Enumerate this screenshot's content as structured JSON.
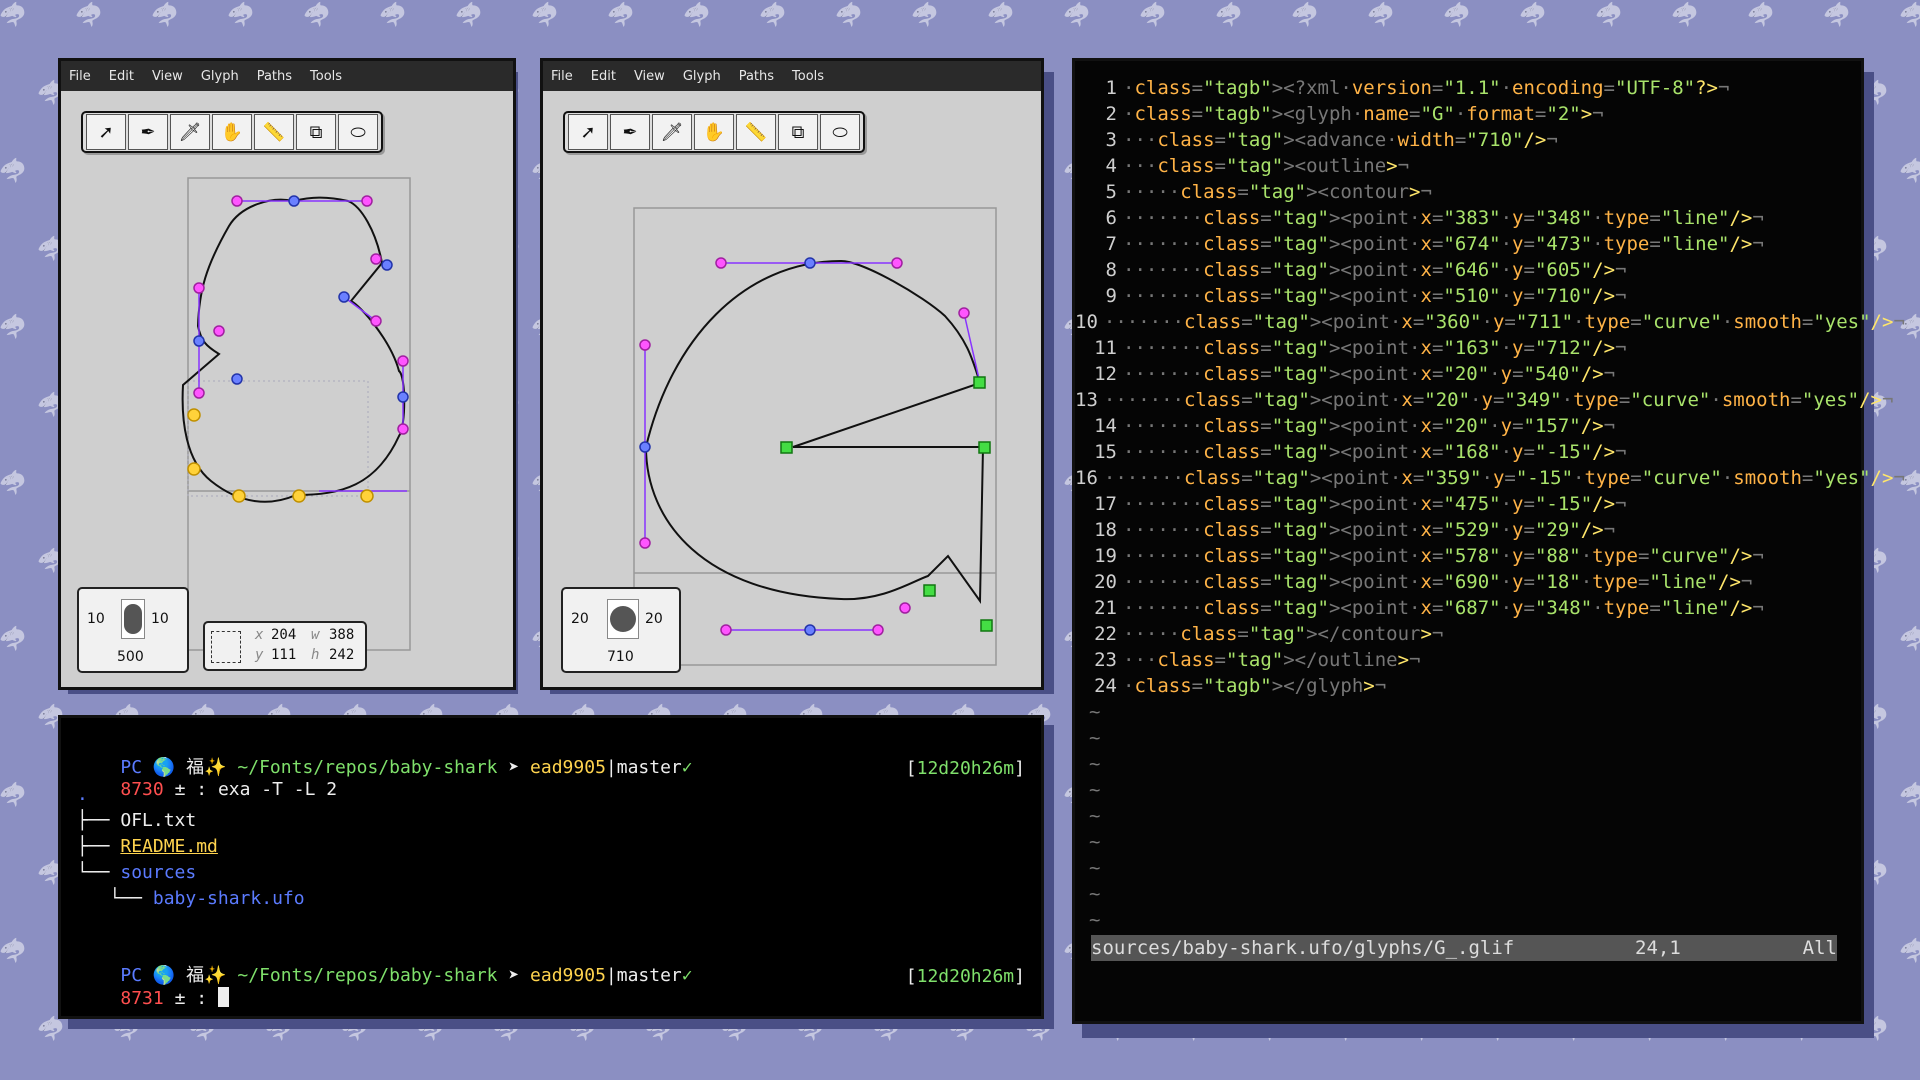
{
  "colors": {
    "background": "#8b8fc2",
    "on_curve": "#4a68ff",
    "off_curve": "#ff33ff",
    "line_point": "#33cc33",
    "selected": "#ffd23a"
  },
  "editor_left": {
    "menu": [
      "File",
      "Edit",
      "View",
      "Glyph",
      "Paths",
      "Tools"
    ],
    "tools": [
      "pointer-icon",
      "pen-icon",
      "knife-icon",
      "hand-icon",
      "ruler-icon",
      "shapes-icon",
      "ellipse-icon"
    ],
    "metrics": {
      "left": "10",
      "right": "10",
      "advance": "500"
    },
    "bbox": {
      "x_label": "x",
      "x": "204",
      "w_label": "w",
      "w": "388",
      "y_label": "y",
      "y": "111",
      "h_label": "h",
      "h": "242"
    }
  },
  "editor_right": {
    "menu": [
      "File",
      "Edit",
      "View",
      "Glyph",
      "Paths",
      "Tools"
    ],
    "tools": [
      "pointer-icon",
      "pen-icon",
      "knife-icon",
      "hand-icon",
      "ruler-icon",
      "shapes-icon",
      "ellipse-icon"
    ],
    "metrics": {
      "left": "20",
      "right": "20",
      "advance": "710"
    }
  },
  "terminal": {
    "prompt1": {
      "host": "PC",
      "globe": "🌎",
      "kanji": "福",
      "sparkle": "✨",
      "path": "~/Fonts/repos/baby-shark",
      "arrow": "➤",
      "commit": "ead9905",
      "branch": "|master",
      "check": "✓"
    },
    "cmd1": {
      "num": "8730",
      "pm": "±",
      "colon": ":",
      "cmd": "exa -T -L 2",
      "time": "12d20h26m"
    },
    "tree": {
      "root": ".",
      "items": [
        {
          "prefix": "├── ",
          "name": "OFL.txt"
        },
        {
          "prefix": "├── ",
          "name": "README.md"
        },
        {
          "prefix": "└── ",
          "name": "sources"
        },
        {
          "prefix": "   └── ",
          "name": "baby-shark.ufo"
        }
      ]
    },
    "prompt2": {
      "host": "PC",
      "globe": "🌎",
      "kanji": "福",
      "sparkle": "✨",
      "path": "~/Fonts/repos/baby-shark",
      "arrow": "➤",
      "commit": "ead9905",
      "branch": "|master",
      "check": "✓"
    },
    "cmd2": {
      "num": "8731",
      "pm": "±",
      "colon": ":",
      "time": "12d20h26m"
    }
  },
  "code": {
    "lines": [
      {
        "n": "1",
        "text": "<?xml version=\"1.1\" encoding=\"UTF-8\"?>¬"
      },
      {
        "n": "2",
        "text": "<glyph name=\"G\" format=\"2\">¬"
      },
      {
        "n": "3",
        "text": "··<advance width=\"710\"/>¬"
      },
      {
        "n": "4",
        "text": "··<outline>¬"
      },
      {
        "n": "5",
        "text": "····<contour>¬"
      },
      {
        "n": "6",
        "text": "······<point x=\"383\" y=\"348\" type=\"line\"/>¬"
      },
      {
        "n": "7",
        "text": "······<point x=\"674\" y=\"473\" type=\"line\"/>¬"
      },
      {
        "n": "8",
        "text": "······<point x=\"646\" y=\"605\"/>¬"
      },
      {
        "n": "9",
        "text": "······<point x=\"510\" y=\"710\"/>¬"
      },
      {
        "n": "10",
        "text": "······<point x=\"360\" y=\"711\" type=\"curve\" smooth=\"yes\"/>¬"
      },
      {
        "n": "11",
        "text": "······<point x=\"163\" y=\"712\"/>¬"
      },
      {
        "n": "12",
        "text": "······<point x=\"20\" y=\"540\"/>¬"
      },
      {
        "n": "13",
        "text": "······<point x=\"20\" y=\"349\" type=\"curve\" smooth=\"yes\"/>¬"
      },
      {
        "n": "14",
        "text": "······<point x=\"20\" y=\"157\"/>¬"
      },
      {
        "n": "15",
        "text": "······<point x=\"168\" y=\"-15\"/>¬"
      },
      {
        "n": "16",
        "text": "······<point x=\"359\" y=\"-15\" type=\"curve\" smooth=\"yes\"/>¬"
      },
      {
        "n": "17",
        "text": "······<point x=\"475\" y=\"-15\"/>¬"
      },
      {
        "n": "18",
        "text": "······<point x=\"529\" y=\"29\"/>¬"
      },
      {
        "n": "19",
        "text": "······<point x=\"578\" y=\"88\" type=\"curve\"/>¬"
      },
      {
        "n": "20",
        "text": "······<point x=\"690\" y=\"18\" type=\"line\"/>¬"
      },
      {
        "n": "21",
        "text": "······<point x=\"687\" y=\"348\" type=\"line\"/>¬"
      },
      {
        "n": "22",
        "text": "····</contour>¬"
      },
      {
        "n": "23",
        "text": "··</outline>¬"
      },
      {
        "n": "24",
        "text": "</glyph>¬"
      }
    ],
    "tilde": "~",
    "status": {
      "file": "sources/baby-shark.ufo/glyphs/G_.glif",
      "pos": "24,1",
      "scroll": "All"
    }
  }
}
